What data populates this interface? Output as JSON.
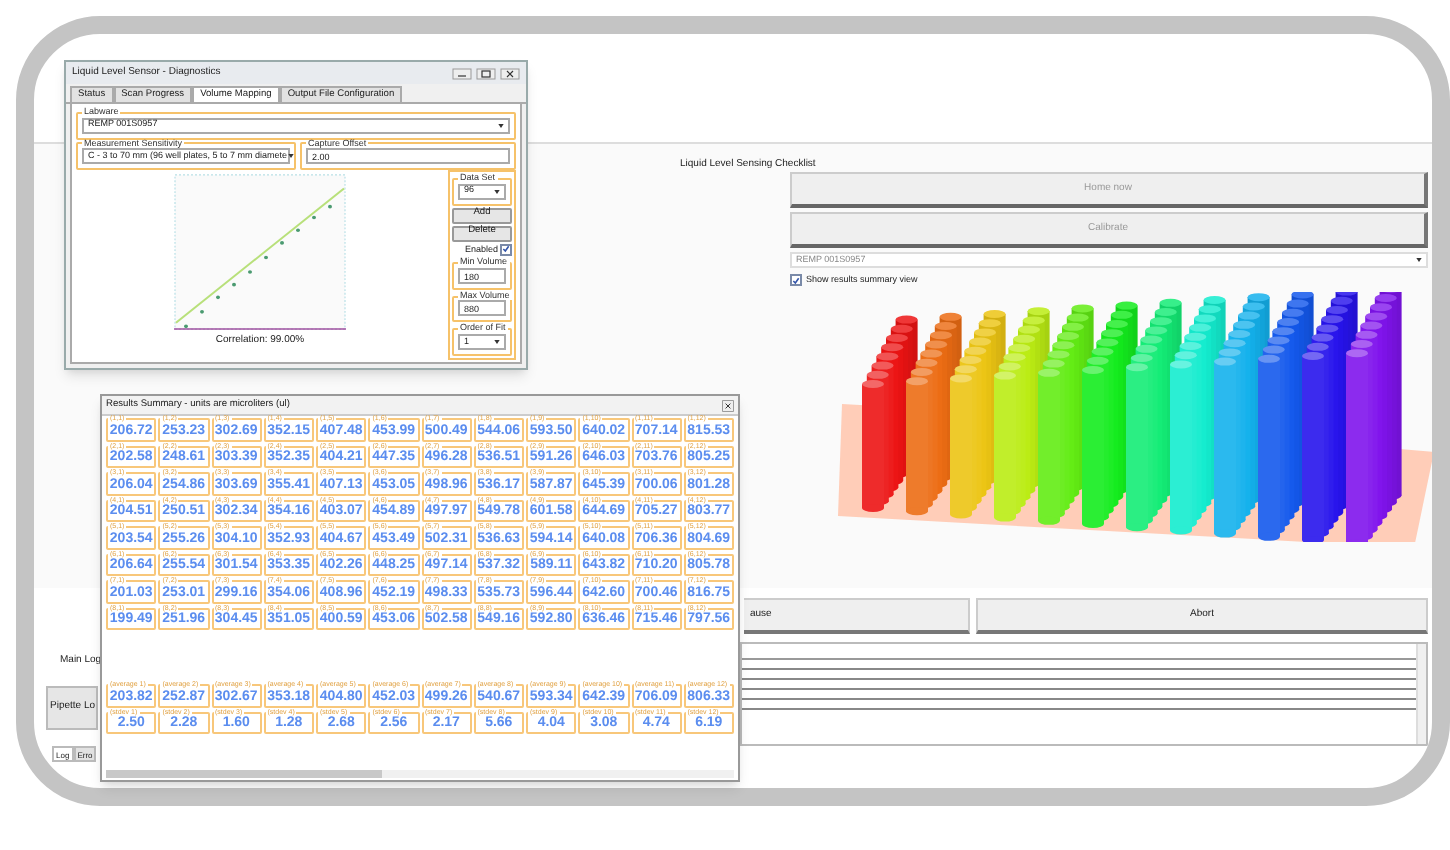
{
  "diagnostics": {
    "title": "Liquid Level Sensor - Diagnostics",
    "tabs": [
      {
        "label": "Status",
        "selected": false
      },
      {
        "label": "Scan Progress",
        "selected": false
      },
      {
        "label": "Volume Mapping",
        "selected": true
      },
      {
        "label": "Output File Configuration",
        "selected": false
      }
    ],
    "labware": {
      "label": "Labware",
      "value": "REMP 001S0957"
    },
    "sensitivity": {
      "label": "Measurement Sensitivity",
      "value": "C - 3 to 70 mm (96 well plates, 5 to 7 mm diamete"
    },
    "capture_offset": {
      "label": "Capture Offset",
      "value": "2.00"
    },
    "correlation": "Correlation: 99.00%",
    "data_set": {
      "label": "Data Set",
      "value": "96"
    },
    "buttons": [
      "Add",
      "Delete"
    ],
    "enabled": {
      "label": "Enabled",
      "checked": true
    },
    "min_volume": {
      "label": "Min Volume",
      "value": "180"
    },
    "max_volume": {
      "label": "Max Volume",
      "value": "880"
    },
    "order_of_fit": {
      "label": "Order of Fit",
      "value": "1"
    }
  },
  "checklist": {
    "title": "Liquid Level Sensing Checklist",
    "buttons": [
      "Home now",
      "Calibrate"
    ],
    "labware": "REMP 001S0957",
    "summary_view": {
      "label": "Show results summary view",
      "checked": true
    }
  },
  "actions": [
    "ause",
    "Abort"
  ],
  "log": {
    "side_tabs": [
      "Main Log",
      "Pipette Lo"
    ],
    "bottom_tabs": [
      {
        "label": "Log",
        "selected": true
      },
      {
        "label": "Erro",
        "selected": false
      }
    ]
  },
  "results": {
    "title": "Results Summary - units are microliters (ul)",
    "rows": [
      {
        "labels": [
          "(1,1)",
          "(1,2)",
          "(1,3)",
          "(1,4)",
          "(1,5)",
          "(1,6)",
          "(1,7)",
          "(1,8)",
          "(1,9)",
          "(1,10)",
          "(1,11)",
          "(1,12)"
        ],
        "values": [
          "206.72",
          "253.23",
          "302.69",
          "352.15",
          "407.48",
          "453.99",
          "500.49",
          "544.06",
          "593.50",
          "640.02",
          "707.14",
          "815.53"
        ]
      },
      {
        "labels": [
          "(2,1)",
          "(2,2)",
          "(2,3)",
          "(2,4)",
          "(2,5)",
          "(2,6)",
          "(2,7)",
          "(2,8)",
          "(2,9)",
          "(2,10)",
          "(2,11)",
          "(2,12)"
        ],
        "values": [
          "202.58",
          "248.61",
          "303.39",
          "352.35",
          "404.21",
          "447.35",
          "496.28",
          "536.51",
          "591.26",
          "646.03",
          "703.76",
          "805.25"
        ]
      },
      {
        "labels": [
          "(3,1)",
          "(3,2)",
          "(3,3)",
          "(3,4)",
          "(3,5)",
          "(3,6)",
          "(3,7)",
          "(3,8)",
          "(3,9)",
          "(3,10)",
          "(3,11)",
          "(3,12)"
        ],
        "values": [
          "206.04",
          "254.86",
          "303.69",
          "355.41",
          "407.13",
          "453.05",
          "498.96",
          "536.17",
          "587.87",
          "645.39",
          "700.06",
          "801.28"
        ]
      },
      {
        "labels": [
          "(4,1)",
          "(4,2)",
          "(4,3)",
          "(4,4)",
          "(4,5)",
          "(4,6)",
          "(4,7)",
          "(4,8)",
          "(4,9)",
          "(4,10)",
          "(4,11)",
          "(4,12)"
        ],
        "values": [
          "204.51",
          "250.51",
          "302.34",
          "354.16",
          "403.07",
          "454.89",
          "497.97",
          "549.78",
          "601.58",
          "644.69",
          "705.27",
          "803.77"
        ]
      },
      {
        "labels": [
          "(5,1)",
          "(5,2)",
          "(5,3)",
          "(5,4)",
          "(5,5)",
          "(5,6)",
          "(5,7)",
          "(5,8)",
          "(5,9)",
          "(5,10)",
          "(5,11)",
          "(5,12)"
        ],
        "values": [
          "203.54",
          "255.26",
          "304.10",
          "352.93",
          "404.67",
          "453.49",
          "502.31",
          "536.63",
          "594.14",
          "640.08",
          "706.36",
          "804.69"
        ]
      },
      {
        "labels": [
          "(6,1)",
          "(6,2)",
          "(6,3)",
          "(6,4)",
          "(6,5)",
          "(6,6)",
          "(6,7)",
          "(6,8)",
          "(6,9)",
          "(6,10)",
          "(6,11)",
          "(6,12)"
        ],
        "values": [
          "206.64",
          "255.54",
          "301.54",
          "353.35",
          "402.26",
          "448.25",
          "497.14",
          "537.32",
          "589.11",
          "643.82",
          "710.20",
          "805.78"
        ]
      },
      {
        "labels": [
          "(7,1)",
          "(7,2)",
          "(7,3)",
          "(7,4)",
          "(7,5)",
          "(7,6)",
          "(7,7)",
          "(7,8)",
          "(7,9)",
          "(7,10)",
          "(7,11)",
          "(7,12)"
        ],
        "values": [
          "201.03",
          "253.01",
          "299.16",
          "354.06",
          "408.96",
          "452.19",
          "498.33",
          "535.73",
          "596.44",
          "642.60",
          "700.46",
          "816.75"
        ]
      },
      {
        "labels": [
          "(8,1)",
          "(8,2)",
          "(8,3)",
          "(8,4)",
          "(8,5)",
          "(8,6)",
          "(8,7)",
          "(8,8)",
          "(8,9)",
          "(8,10)",
          "(8,11)",
          "(8,12)"
        ],
        "values": [
          "199.49",
          "251.96",
          "304.45",
          "351.05",
          "400.59",
          "453.06",
          "502.58",
          "549.16",
          "592.80",
          "636.46",
          "715.46",
          "797.56"
        ]
      }
    ],
    "summary_rows": [
      {
        "labels": [
          "(average 1)",
          "(average 2)",
          "(average 3)",
          "(average 4)",
          "(average 5)",
          "(average 6)",
          "(average 7)",
          "(average 8)",
          "(average 9)",
          "(average 10)",
          "(average 11)",
          "(average 12)"
        ],
        "values": [
          "203.82",
          "252.87",
          "302.67",
          "353.18",
          "404.80",
          "452.03",
          "499.26",
          "540.67",
          "593.34",
          "642.39",
          "706.09",
          "806.33"
        ]
      },
      {
        "labels": [
          "(stdev 1)",
          "(stdev 2)",
          "(stdev 3)",
          "(stdev 4)",
          "(stdev 5)",
          "(stdev 6)",
          "(stdev 7)",
          "(stdev 8)",
          "(stdev 9)",
          "(stdev 10)",
          "(stdev 11)",
          "(stdev 12)"
        ],
        "values": [
          "2.50",
          "2.28",
          "1.60",
          "1.28",
          "2.68",
          "2.56",
          "2.17",
          "5.66",
          "4.04",
          "3.08",
          "4.74",
          "6.19"
        ]
      }
    ]
  }
}
